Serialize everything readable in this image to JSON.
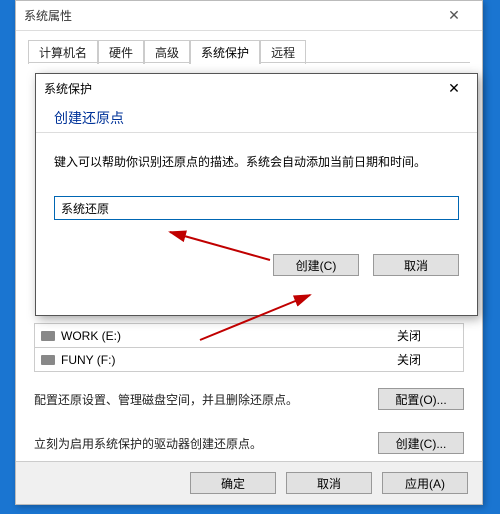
{
  "parent": {
    "title": "系统属性",
    "tabs": [
      "计算机名",
      "硬件",
      "高级",
      "系统保护",
      "远程"
    ],
    "activeTabIndex": 3,
    "drives": [
      {
        "name": "WORK (E:)",
        "status": "关闭"
      },
      {
        "name": "FUNY (F:)",
        "status": "关闭"
      }
    ],
    "configure_text": "配置还原设置、管理磁盘空间，并且删除还原点。",
    "configure_btn": "配置(O)...",
    "create_text": "立刻为启用系统保护的驱动器创建还原点。",
    "create_btn": "创建(C)...",
    "ok": "确定",
    "cancel": "取消",
    "apply": "应用(A)"
  },
  "dialog": {
    "title": "系统保护",
    "heading": "创建还原点",
    "description": "键入可以帮助你识别还原点的描述。系统会自动添加当前日期和时间。",
    "input_value": "系统还原",
    "create": "创建(C)",
    "cancel": "取消"
  }
}
